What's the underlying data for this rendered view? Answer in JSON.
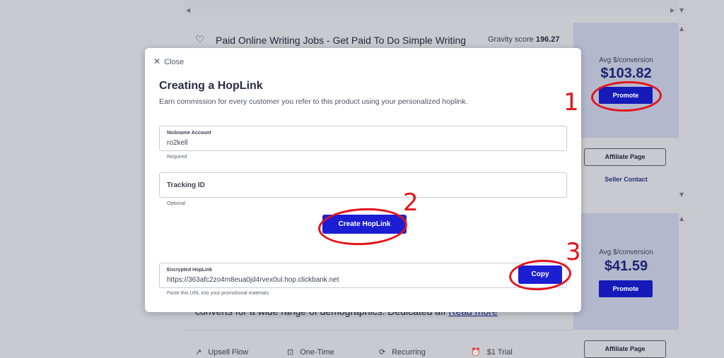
{
  "product1": {
    "title": "Paid Online Writing Jobs - Get Paid To Do Simple Writing Jobs Online",
    "gravity_label": "Gravity score",
    "gravity_value": "196.27",
    "avg_label": "Avg $/conversion",
    "avg_value": "$103.82",
    "promote_label": "Promote",
    "affiliate_label": "Affiliate Page",
    "seller_label": "Seller Contact"
  },
  "product2": {
    "description": "converts for a wide range of demographics. Dedicated aff",
    "read_more": "Read more",
    "avg_label": "Avg $/conversion",
    "avg_value": "$41.59",
    "promote_label": "Promote",
    "affiliate_label": "Affiliate Page",
    "features": [
      {
        "icon": "trend-up-icon",
        "label": "Upsell Flow"
      },
      {
        "icon": "dollar-box-icon",
        "label": "One-Time"
      },
      {
        "icon": "recurring-icon",
        "label": "Recurring"
      },
      {
        "icon": "alarm-clock-icon",
        "label": "$1 Trial"
      }
    ]
  },
  "modal": {
    "close_label": "Close",
    "title": "Creating a HopLink",
    "subtitle": "Earn commission for every customer you refer to this product using your personalized hoplink.",
    "nickname_label": "Nickname Account",
    "nickname_value": "ro2kell",
    "nickname_hint": "Required",
    "tracking_label": "Tracking ID",
    "tracking_hint": "Optional",
    "create_button": "Create HopLink",
    "encrypted_label": "Encrypted HopLink",
    "encrypted_value": "https://363afc2zo4m8eua0jd4rvex0ul.hop.clickbank.net",
    "encrypted_hint": "Paste this URL into your promotional materials.",
    "copy_button": "Copy"
  },
  "annotations": [
    "1",
    "2",
    "3"
  ],
  "colors": {
    "accent": "#1b1ed3",
    "annotation_red": "#e2141a",
    "side_panel": "#b4b8cd"
  }
}
